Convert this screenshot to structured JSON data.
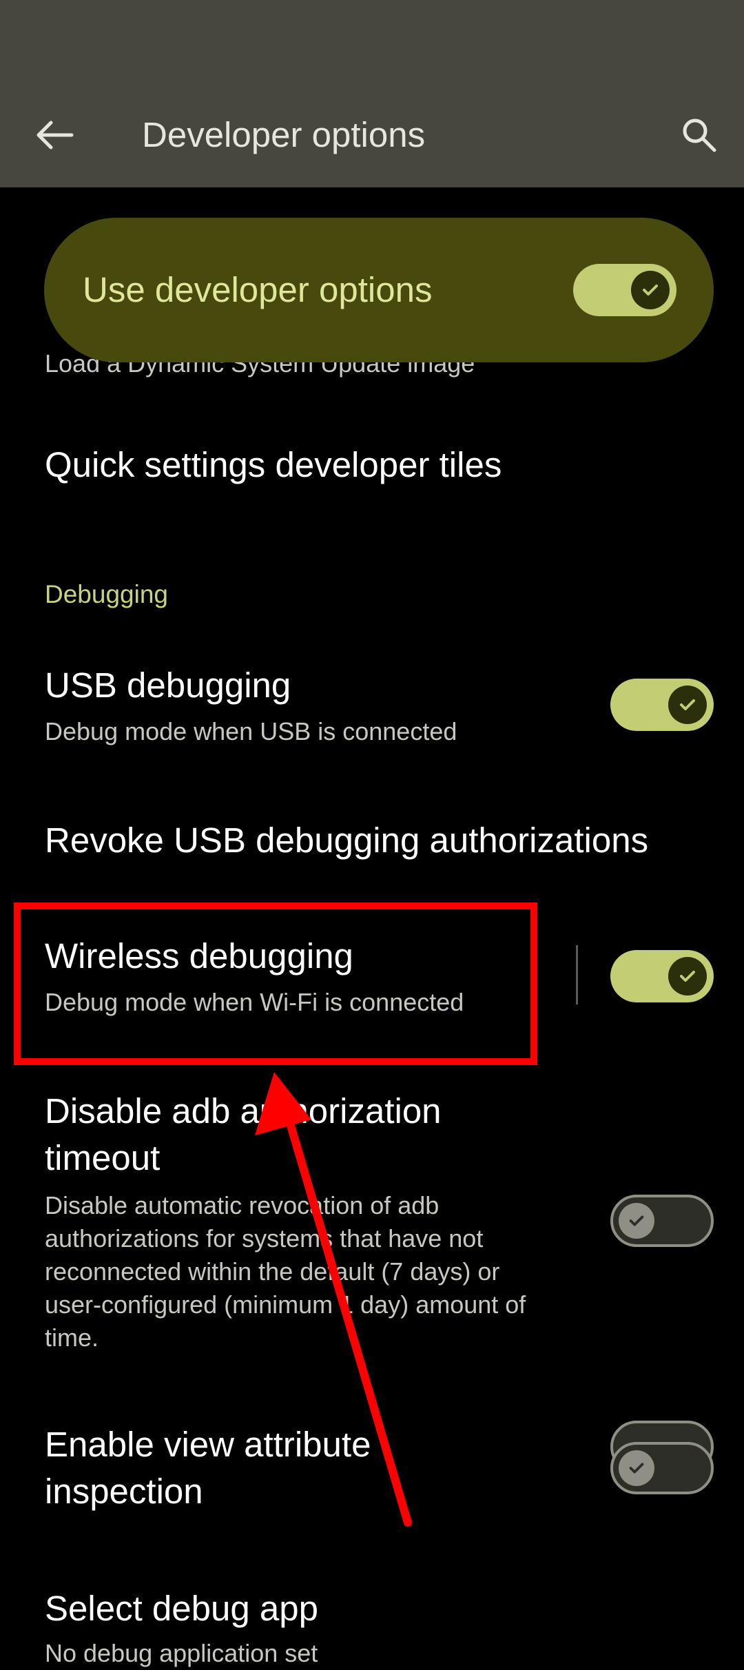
{
  "appbar": {
    "title": "Developer options",
    "back_icon": "arrow-left-icon",
    "search_icon": "search-icon"
  },
  "master_toggle": {
    "label": "Use developer options",
    "state": "on"
  },
  "partial_item": {
    "subtitle": "Load a Dynamic System Update image"
  },
  "items": {
    "quick_settings": {
      "title": "Quick settings developer tiles"
    },
    "debugging_header": "Debugging",
    "usb_debugging": {
      "title": "USB debugging",
      "subtitle": "Debug mode when USB is connected",
      "state": "on"
    },
    "revoke": {
      "title": "Revoke USB debugging authorizations"
    },
    "wireless_debugging": {
      "title": "Wireless debugging",
      "subtitle": "Debug mode when Wi-Fi is connected",
      "state": "on"
    },
    "adb_timeout": {
      "title_line1": "Disable adb authorization",
      "title_line2": "timeout",
      "subtitle_lines": [
        "Disable automatic revocation of adb",
        "authorizations for systems that have not",
        "reconnected within the default (7 days) or",
        "user-configured (minimum 1 day) amount of",
        "time."
      ],
      "state": "off"
    },
    "view_attribute": {
      "title_line1": "Enable view attribute",
      "title_line2": "inspection",
      "state": "off"
    },
    "select_debug_app": {
      "title": "Select debug app",
      "subtitle": "No debug application set"
    }
  },
  "colors": {
    "appbar_bg": "#47473f",
    "page_bg": "#000000",
    "accent": "#c6d47f",
    "master_card_bg": "#474a0c",
    "switch_on": "#c3cd74",
    "annotation_red": "#ff0000"
  }
}
